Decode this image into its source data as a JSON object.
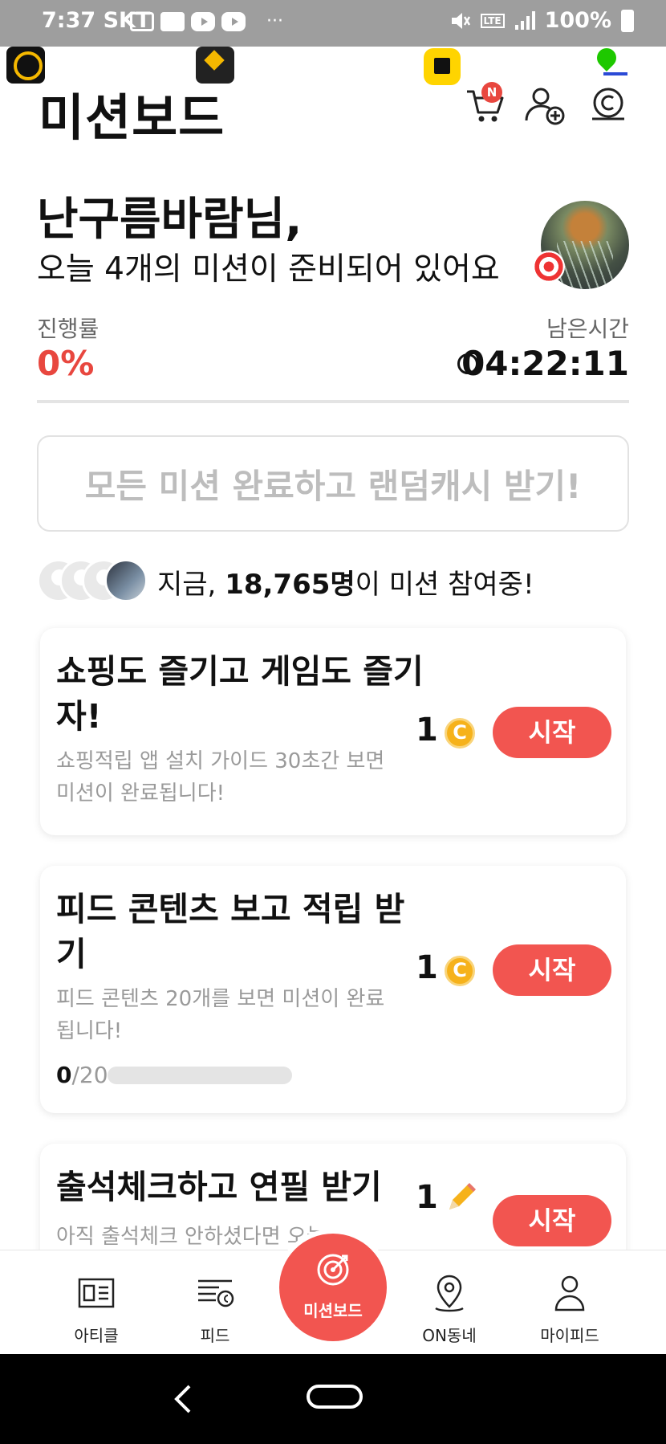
{
  "status_bar": {
    "time": "7:37",
    "carrier": "SKT",
    "battery": "100%",
    "dots": "···",
    "network": "LTE"
  },
  "header": {
    "title": "미션보드",
    "cart_badge": "N"
  },
  "greeting": {
    "name": "난구름바람님,",
    "subtitle": "오늘 4개의 미션이 준비되어 있어요"
  },
  "progress": {
    "label": "진행률",
    "value": "0%",
    "time_label": "남은시간",
    "time_value": "04:22:11"
  },
  "random_cash": {
    "text": "모든 미션 완료하고 랜덤캐시 받기!"
  },
  "participants": {
    "prefix": "지금, ",
    "count": "18,765명",
    "suffix": "이 미션 참여중!"
  },
  "missions": [
    {
      "title": "쇼핑도 즐기고 게임도 즐기자!",
      "desc": "쇼핑적립 앱 설치 가이드 30초간 보면 미션이 완료됩니다!",
      "reward": "1",
      "reward_icon": "coin-icon",
      "button": "시작"
    },
    {
      "title": "피드 콘텐츠 보고 적립 받기",
      "desc": "피드 콘텐츠 20개를 보면 미션이 완료됩니다!",
      "reward": "1",
      "reward_icon": "coin-icon",
      "button": "시작",
      "progress_current": "0",
      "progress_total": "/20",
      "progress_fraction": 0
    },
    {
      "title": "출석체크하고 연필 받기",
      "desc": "아직 출석체크 안하셨다면 오늘",
      "reward": "1",
      "reward_icon": "pencil-icon",
      "button": "시작"
    }
  ],
  "bottom_nav": {
    "items": [
      {
        "label": "아티클",
        "icon": "article-icon"
      },
      {
        "label": "피드",
        "icon": "feed-icon"
      },
      {
        "label": "미션보드",
        "icon": "target-icon"
      },
      {
        "label": "ON동네",
        "icon": "location-pin-icon"
      },
      {
        "label": "마이피드",
        "icon": "person-icon"
      }
    ]
  },
  "colors": {
    "accent": "#f25550",
    "progress_red": "#e8473f",
    "coin": "#f6b21b",
    "muted": "#9a9a9a"
  }
}
